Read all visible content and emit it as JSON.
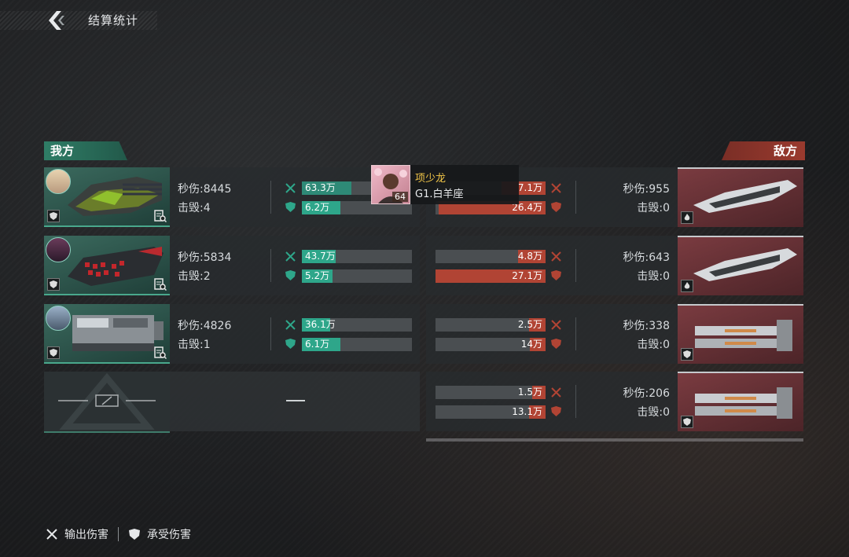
{
  "header": {
    "title": "结算统计"
  },
  "sides": {
    "ally": "我方",
    "enemy": "敌方"
  },
  "tooltip": {
    "name": "项少龙",
    "subtitle": "G1.白羊座",
    "level": "64"
  },
  "ally_rows": [
    {
      "dps": "秒伤:8445",
      "kills": "击毁:4",
      "out": "63.3万",
      "out_frac": 0.45,
      "taken": "6.2万",
      "taken_frac": 0.35
    },
    {
      "dps": "秒伤:5834",
      "kills": "击毁:2",
      "out": "43.7万",
      "out_frac": 0.31,
      "taken": "5.2万",
      "taken_frac": 0.28
    },
    {
      "dps": "秒伤:4826",
      "kills": "击毁:1",
      "out": "36.1万",
      "out_frac": 0.26,
      "taken": "6.1万",
      "taken_frac": 0.35
    }
  ],
  "empty_slot": {
    "dash": "—"
  },
  "enemy_rows": [
    {
      "dps": "秒伤:955",
      "kills": "击毁:0",
      "out": "7.1万",
      "out_frac": 0.4,
      "taken": "26.4万",
      "taken_frac": 0.97
    },
    {
      "dps": "秒伤:643",
      "kills": "击毁:0",
      "out": "4.8万",
      "out_frac": 0.25,
      "taken": "27.1万",
      "taken_frac": 1.0
    },
    {
      "dps": "秒伤:338",
      "kills": "击毁:0",
      "out": "2.5万",
      "out_frac": 0.15,
      "taken": "14万",
      "taken_frac": 0.14
    },
    {
      "dps": "秒伤:206",
      "kills": "击毁:0",
      "out": "1.5万",
      "out_frac": 0.12,
      "taken": "13.1万",
      "taken_frac": 0.15
    }
  ],
  "legend": {
    "damage_out": "输出伤害",
    "damage_taken": "承受伤害"
  },
  "colors": {
    "ally": "#2ea68a",
    "enemy": "#b14434",
    "title_gold": "#f2c648"
  }
}
